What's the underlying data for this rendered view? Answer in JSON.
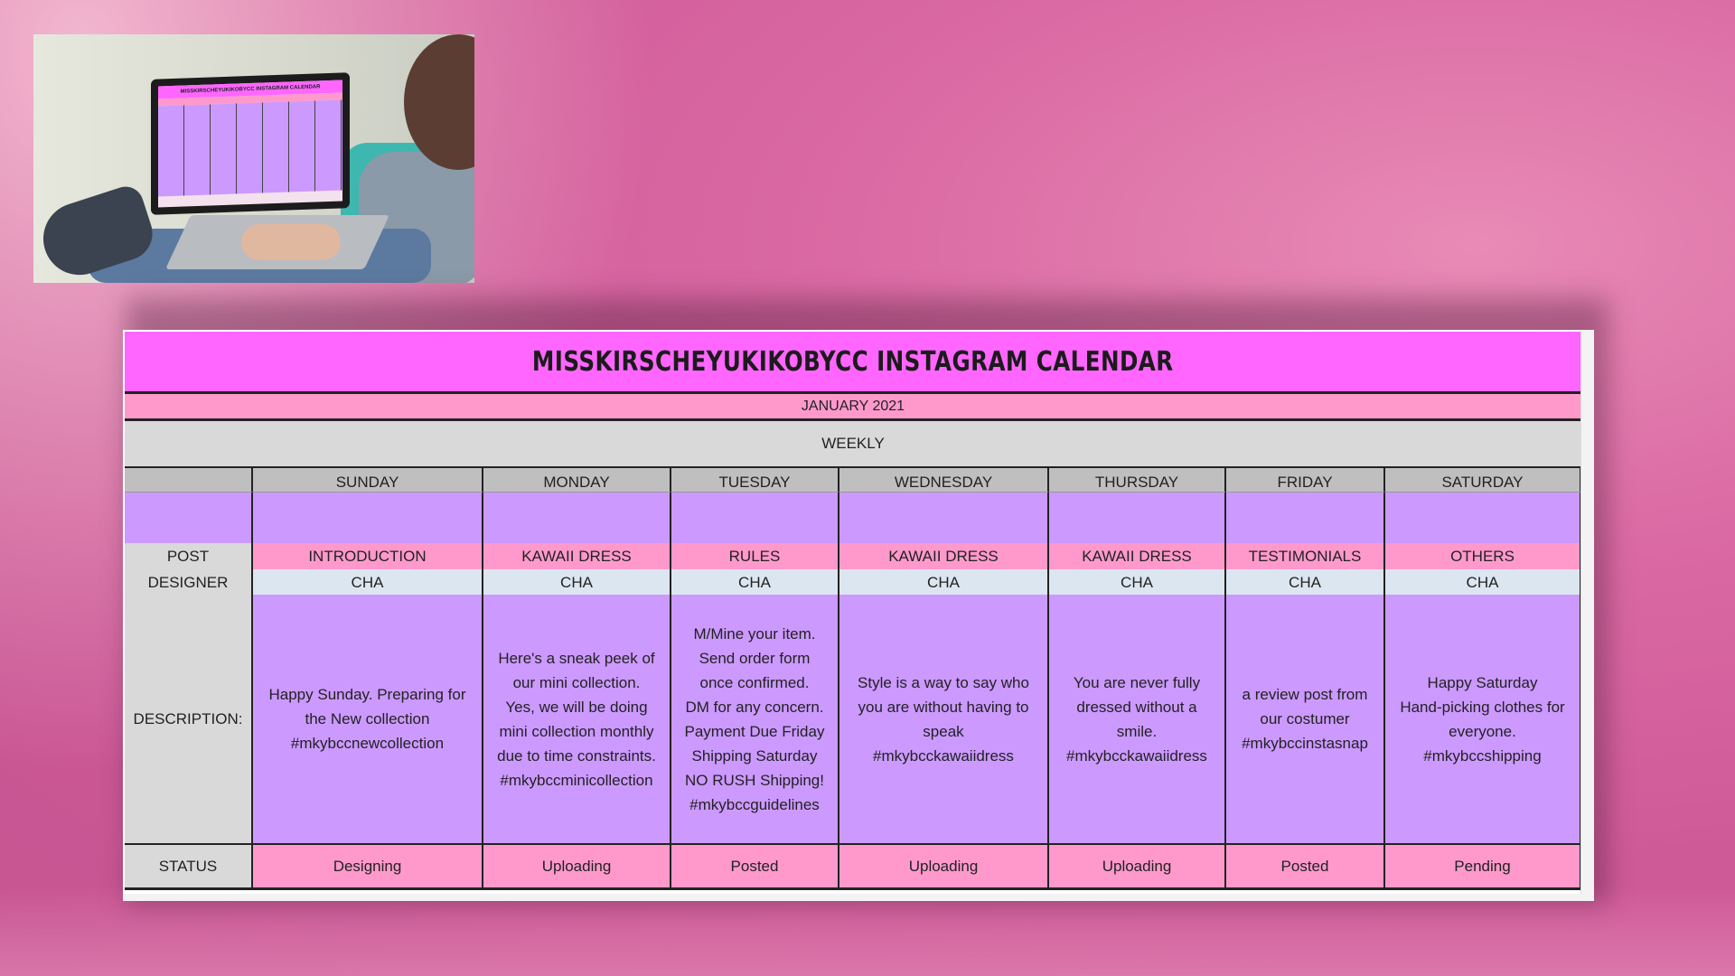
{
  "calendar": {
    "title": "MISSKIRSCHEYUKIKOBYCC INSTAGRAM CALENDAR",
    "month": "JANUARY 2021",
    "period": "WEEKLY",
    "days": [
      "SUNDAY",
      "MONDAY",
      "TUESDAY",
      "WEDNESDAY",
      "THURSDAY",
      "FRIDAY",
      "SATURDAY"
    ],
    "row_labels": {
      "post": "POST",
      "designer": "DESIGNER",
      "description": "DESCRIPTION:",
      "status": "STATUS"
    },
    "posts": [
      "INTRODUCTION",
      "KAWAII DRESS",
      "RULES",
      "KAWAII DRESS",
      "KAWAII DRESS",
      "TESTIMONIALS",
      "OTHERS"
    ],
    "designers": [
      "CHA",
      "CHA",
      "CHA",
      "CHA",
      "CHA",
      "CHA",
      "CHA"
    ],
    "descriptions": [
      "Happy Sunday. Preparing for\nthe New collection\n#mkybccnewcollection",
      "Here's a sneak peek of\nour mini collection.\nYes, we will be doing\nmini collection monthly\ndue to time constraints.\n#mkybccminicollection",
      "M/Mine your item.\nSend order form\nonce confirmed.\nDM for any concern.\nPayment Due Friday\nShipping Saturday\nNO RUSH Shipping!\n#mkybccguidelines",
      "Style is a way to say who\nyou are without having to\nspeak\n#mkybcckawaiidress",
      "You are never fully\ndressed without a\nsmile.\n#mkybcckawaiidress",
      "a review post from\nour costumer\n#mkybccinstasnap",
      "Happy Saturday\nHand-picking clothes for\neveryone.\n#mkybccshipping"
    ],
    "statuses": [
      "Designing",
      "Uploading",
      "Posted",
      "Uploading",
      "Uploading",
      "Posted",
      "Pending"
    ]
  },
  "photo": {
    "mini_title": "MISSKIRSCHEYUKIKOBYCC INSTAGRAM CALENDAR"
  },
  "colors": {
    "title_bg": "#ff66ff",
    "band_pink": "#ff99cc",
    "lavender": "#cc99ff",
    "header_gray": "#bfbfbf",
    "designer_blue": "#dce6f1"
  }
}
